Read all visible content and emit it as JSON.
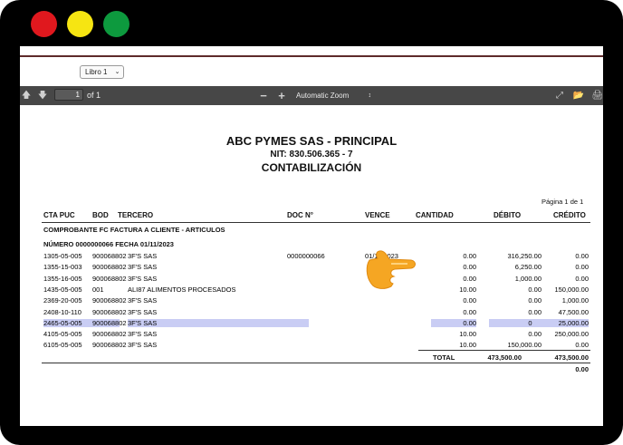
{
  "toolbar": {
    "page_input": "1",
    "page_of": "of 1",
    "zoom_select": "Automatic Zoom",
    "book_select": "Libro 1"
  },
  "report": {
    "company": "ABC PYMES SAS - PRINCIPAL",
    "nit": "NIT: 830.506.365 - 7",
    "title": "CONTABILIZACIÓN",
    "page_info": "Página 1 de 1",
    "columns": [
      "CTA PUC",
      "BOD",
      "TERCERO",
      "DOC N°",
      "VENCE",
      "CANTIDAD",
      "DÉBITO",
      "CRÉDITO"
    ],
    "section_title": "COMPROBANTE FC FACTURA A CLIENTE - ARTICULOS",
    "number_line": "NÚMERO 0000000066 FECHA 01/11/2023",
    "rows": [
      {
        "cta": "1305-05-005",
        "bod": "900068802",
        "tercero": "3F'S SAS",
        "doc": "0000000066",
        "vence": "01/11/2023",
        "cantidad": "0.00",
        "debito": "316,250.00",
        "credito": "0.00"
      },
      {
        "cta": "1355-15-003",
        "bod": "900068802",
        "tercero": "3F'S SAS",
        "doc": "",
        "vence": "",
        "cantidad": "0.00",
        "debito": "6,250.00",
        "credito": "0.00"
      },
      {
        "cta": "1355-16-005",
        "bod": "900068802",
        "tercero": "3F'S SAS",
        "doc": "",
        "vence": "",
        "cantidad": "0.00",
        "debito": "1,000.00",
        "credito": "0.00"
      },
      {
        "cta": "1435-05-005",
        "bod": "001",
        "tercero": "ALI87 ALIMENTOS PROCESADOS",
        "doc": "",
        "vence": "",
        "cantidad": "10.00",
        "debito": "0.00",
        "credito": "150,000.00"
      },
      {
        "cta": "2369-20-005",
        "bod": "900068802",
        "tercero": "3F'S SAS",
        "doc": "",
        "vence": "",
        "cantidad": "0.00",
        "debito": "0.00",
        "credito": "1,000.00"
      },
      {
        "cta": "2408-10-110",
        "bod": "900068802",
        "tercero": "3F'S SAS",
        "doc": "",
        "vence": "",
        "cantidad": "0.00",
        "debito": "0.00",
        "credito": "47,500.00"
      },
      {
        "cta": "2465-05-005",
        "bod": "900068802",
        "tercero": "3F'S SAS",
        "doc": "",
        "vence": "",
        "cantidad": "0.00",
        "debito": "0.00",
        "credito": "25,000.00"
      },
      {
        "cta": "4105-05-005",
        "bod": "900068802",
        "tercero": "3F'S SAS",
        "doc": "",
        "vence": "",
        "cantidad": "10.00",
        "debito": "0.00",
        "credito": "250,000.00"
      },
      {
        "cta": "6105-05-005",
        "bod": "900068802",
        "tercero": "3F'S SAS",
        "doc": "",
        "vence": "",
        "cantidad": "10.00",
        "debito": "150,000.00",
        "credito": "0.00"
      }
    ],
    "total_label": "TOTAL",
    "total_debito": "473,500.00",
    "total_credito": "473,500.00",
    "difference": "0.00"
  },
  "colors": {
    "highlight": "#c9cdf4",
    "toolbar": "#474747",
    "accent_line": "#5e2a2a",
    "hand": "#f5a623"
  }
}
